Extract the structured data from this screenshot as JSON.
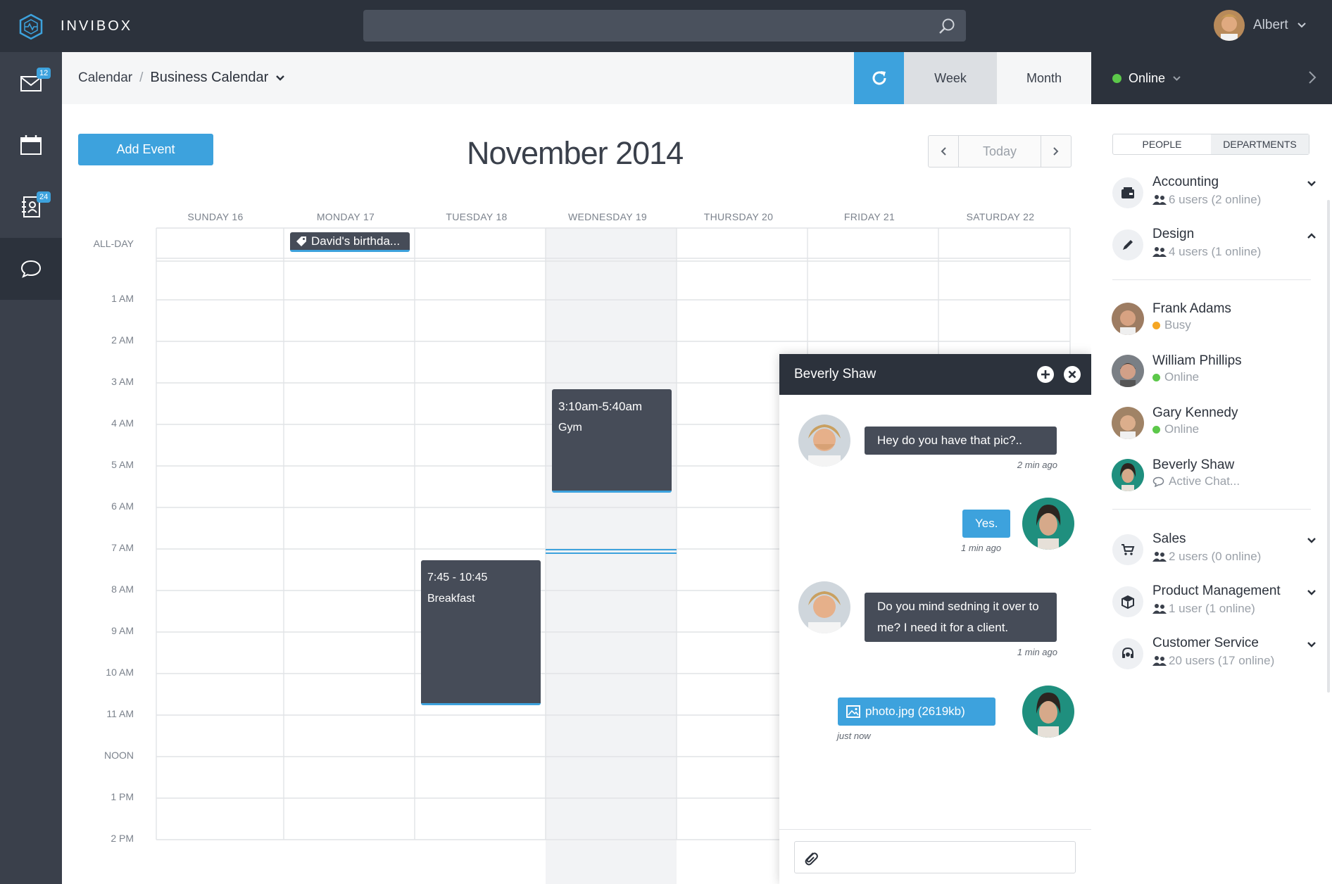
{
  "app": {
    "name": "INVIBOX",
    "user_name": "Albert"
  },
  "search": {
    "placeholder": ""
  },
  "sidebar": {
    "mail_badge": "12",
    "contacts_badge": "24"
  },
  "breadcrumb": {
    "root": "Calendar",
    "separator": "/",
    "current": "Business Calendar"
  },
  "view": {
    "week_label": "Week",
    "month_label": "Month",
    "active": "Week"
  },
  "calendar": {
    "add_event_label": "Add Event",
    "title": "November 2014",
    "today_label": "Today",
    "days": [
      "SUNDAY 16",
      "MONDAY 17",
      "TUESDAY 18",
      "WEDNESDAY 19",
      "THURSDAY 20",
      "FRIDAY 21",
      "SATURDAY 22"
    ],
    "allday_label": "ALL-DAY",
    "allday_event": "David's birthda...",
    "hours": [
      "1 AM",
      "2 AM",
      "3 AM",
      "4 AM",
      "5 AM",
      "6 AM",
      "7 AM",
      "8 AM",
      "9 AM",
      "10 AM",
      "11 AM",
      "NOON",
      "1 PM",
      "2 PM"
    ],
    "events": [
      {
        "time": "3:10am-5:40am",
        "title": "Gym",
        "day": "WEDNESDAY 19"
      },
      {
        "time": "7:45 - 10:45",
        "title": "Breakfast",
        "day": "TUESDAY 18"
      }
    ]
  },
  "chat": {
    "title": "Beverly Shaw",
    "messages": [
      {
        "text": "Hey do you have that pic?..",
        "time": "2 min ago",
        "from": "other"
      },
      {
        "text": "Yes.",
        "time": "1 min ago",
        "from": "me"
      },
      {
        "text": "Do you mind sedning it over to me?  I need it for a client.",
        "time": "1 min ago",
        "from": "other"
      },
      {
        "text": "photo.jpg (2619kb)",
        "time": "just now",
        "from": "me"
      }
    ]
  },
  "right_panel": {
    "status": "Online",
    "tabs": [
      "PEOPLE",
      "DEPARTMENTS"
    ],
    "departments_top": [
      {
        "name": "Accounting",
        "users": "6 users (2 online)",
        "icon": "wallet-icon",
        "expanded": false
      },
      {
        "name": "Design",
        "users": "4 users (1 online)",
        "icon": "pencil-icon",
        "expanded": true
      }
    ],
    "people": [
      {
        "name": "Frank Adams",
        "status": "Busy",
        "status_color": "#f5a623"
      },
      {
        "name": "William Phillips",
        "status": "Online",
        "status_color": "#5cc84a"
      },
      {
        "name": "Gary Kennedy",
        "status": "Online",
        "status_color": "#5cc84a"
      },
      {
        "name": "Beverly Shaw",
        "status": "Active Chat...",
        "status_color": "#9aa0a8"
      }
    ],
    "departments_bottom": [
      {
        "name": "Sales",
        "users": "2 users (0 online)",
        "icon": "cart-icon"
      },
      {
        "name": "Product Management",
        "users": "1 user (1 online)",
        "icon": "box-icon"
      },
      {
        "name": "Customer Service",
        "users": "20 users (17 online)",
        "icon": "headset-icon"
      }
    ]
  },
  "colors": {
    "accent": "#3da2dd",
    "dark": "#2c323c",
    "event": "#464c58",
    "online": "#5cc84a",
    "busy": "#f5a623"
  }
}
